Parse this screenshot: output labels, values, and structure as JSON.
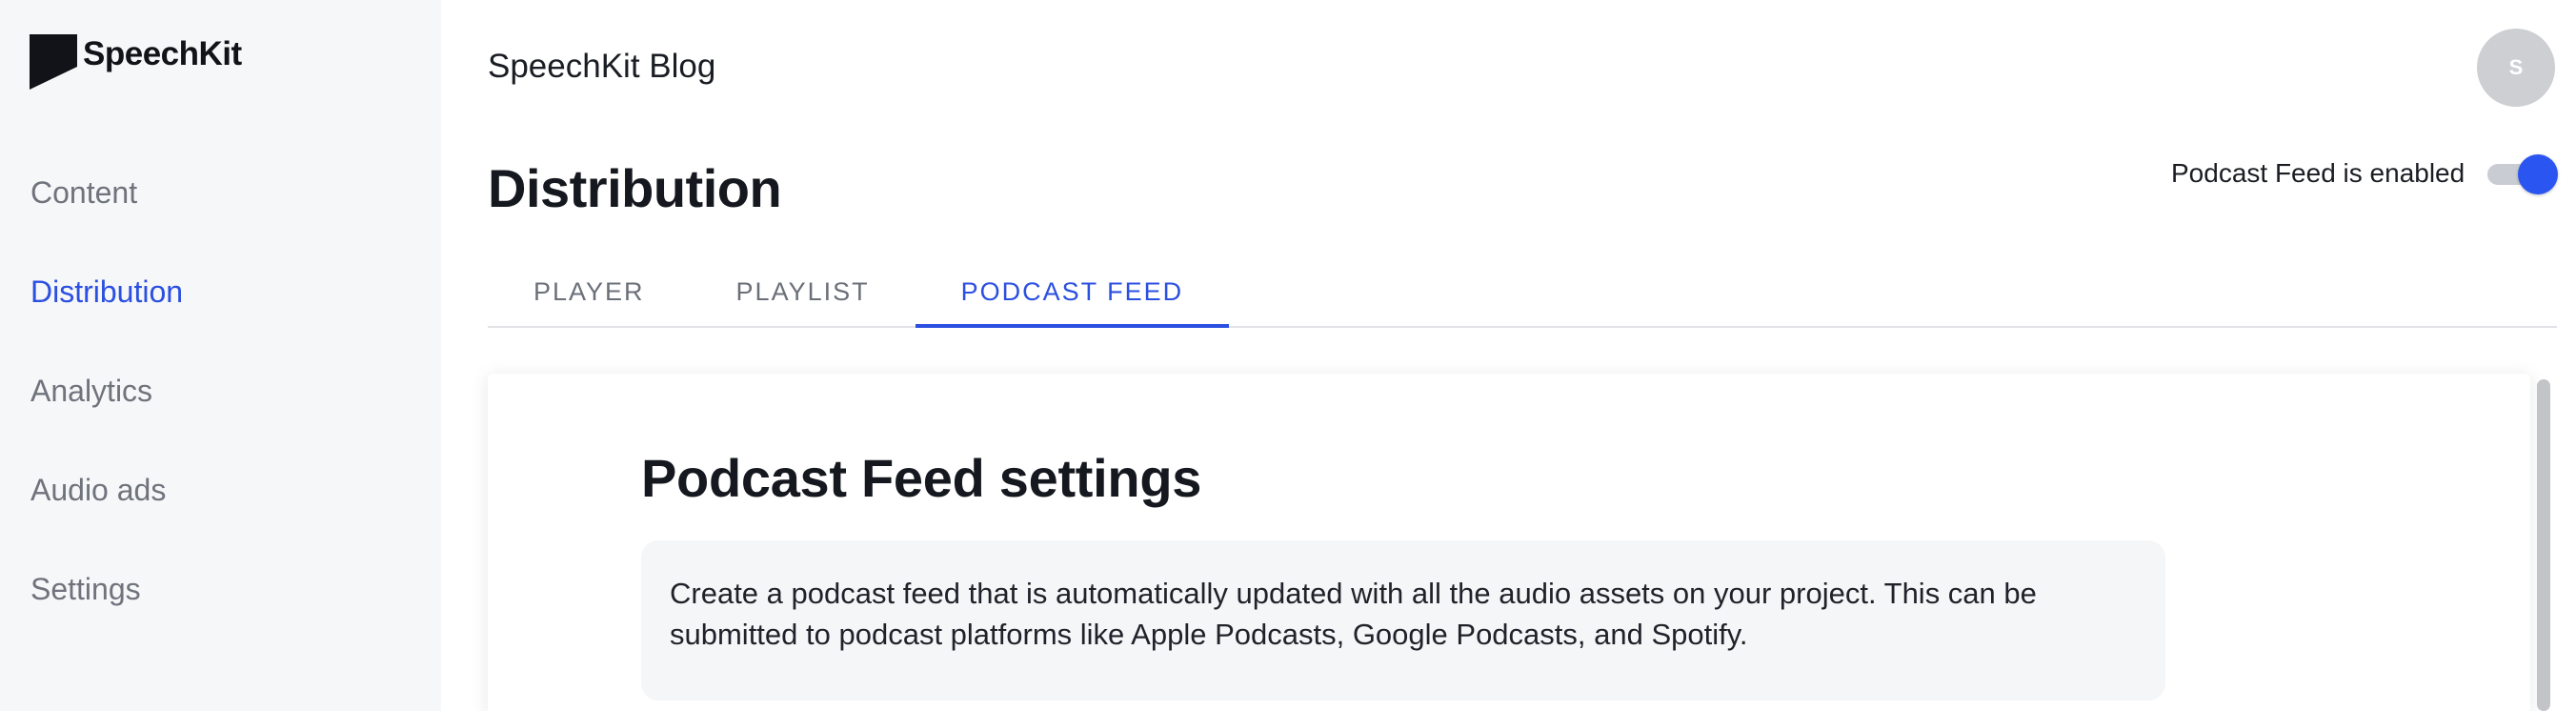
{
  "brand": {
    "name": "SpeechKit",
    "logo_icon": "speechkit-logo-icon"
  },
  "sidebar": {
    "items": [
      {
        "label": "Content",
        "active": false
      },
      {
        "label": "Distribution",
        "active": true
      },
      {
        "label": "Analytics",
        "active": false
      },
      {
        "label": "Audio ads",
        "active": false
      },
      {
        "label": "Settings",
        "active": false
      }
    ]
  },
  "header": {
    "project_title": "SpeechKit Blog",
    "avatar_initial": "S",
    "page_title": "Distribution"
  },
  "feed_status": {
    "label": "Podcast Feed is enabled",
    "enabled": true
  },
  "tabs": [
    {
      "label": "PLAYER",
      "active": false
    },
    {
      "label": "PLAYLIST",
      "active": false
    },
    {
      "label": "PODCAST FEED",
      "active": true
    }
  ],
  "card": {
    "title": "Podcast Feed settings",
    "description": "Create a podcast feed that is automatically updated with all the audio assets on your project. This can be submitted to podcast platforms like Apple Podcasts, Google Podcasts, and Spotify."
  },
  "colors": {
    "accent": "#2b4fe0",
    "toggle_on": "#2b55f0",
    "sidebar_bg": "#f6f7f9"
  }
}
